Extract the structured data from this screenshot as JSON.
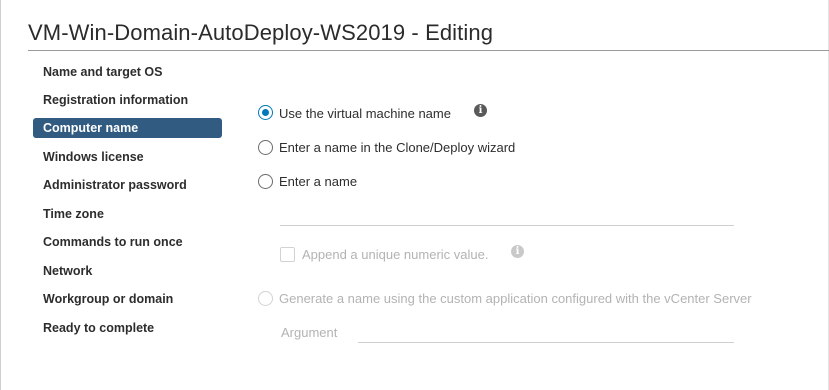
{
  "dialog": {
    "title": "VM-Win-Domain-AutoDeploy-WS2019 - Editing"
  },
  "nav": {
    "items": [
      {
        "label": "Name and target OS",
        "active": false
      },
      {
        "label": "Registration information",
        "active": false
      },
      {
        "label": "Computer name",
        "active": true
      },
      {
        "label": "Windows license",
        "active": false
      },
      {
        "label": "Administrator password",
        "active": false
      },
      {
        "label": "Time zone",
        "active": false
      },
      {
        "label": "Commands to run once",
        "active": false
      },
      {
        "label": "Network",
        "active": false
      },
      {
        "label": "Workgroup or domain",
        "active": false
      },
      {
        "label": "Ready to complete",
        "active": false
      }
    ]
  },
  "computer_name": {
    "option_vm_name": "Use the virtual machine name",
    "option_wizard": "Enter a name in the Clone/Deploy wizard",
    "option_enter": "Enter a name",
    "name_value": "",
    "append_numeric_label": "Append a unique numeric value.",
    "option_custom_app": "Generate a name using the custom application configured with the vCenter Server",
    "argument_label": "Argument",
    "argument_value": "",
    "selected_option": "Use the virtual machine name"
  },
  "colors": {
    "accent": "#0079b8",
    "nav_active_bg": "#325b82"
  },
  "icons": {
    "info": "info-icon"
  }
}
